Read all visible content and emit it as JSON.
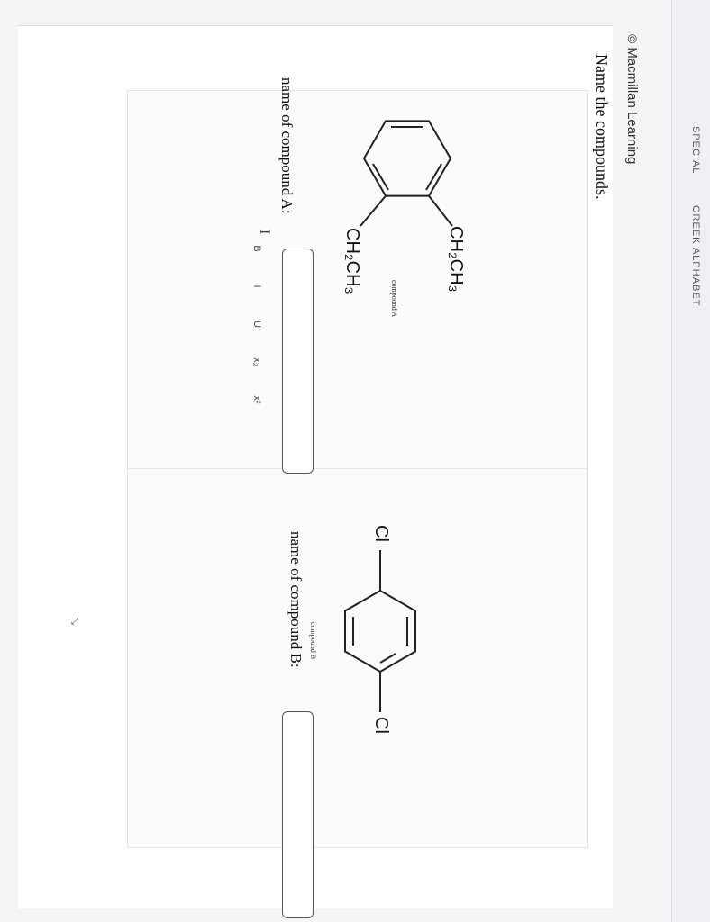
{
  "brand": {
    "copyright_symbol": "©",
    "name": "Macmillan Learning"
  },
  "tabs": [
    {
      "label": "SPECIAL"
    },
    {
      "label": "GREEK ALPHABET"
    }
  ],
  "question": {
    "instruction": "Name the compounds."
  },
  "compound_a": {
    "substituent_top": "CH₂CH₃",
    "substituent_bottom": "CH₂CH₃",
    "caption": "compound A",
    "answer_label": "name of compound A:",
    "answer_value": ""
  },
  "compound_b": {
    "substituent_left": "Cl",
    "substituent_right": "Cl",
    "caption": "compound B",
    "answer_label": "name of compound B:",
    "answer_value": ""
  },
  "format_toolbar": {
    "bold": "B",
    "italic": "I",
    "underline": "U",
    "subscript": "x₂",
    "superscript": "x²"
  },
  "icons": {
    "resize": "resize-corner-icon",
    "cursor": "text-cursor-icon"
  }
}
